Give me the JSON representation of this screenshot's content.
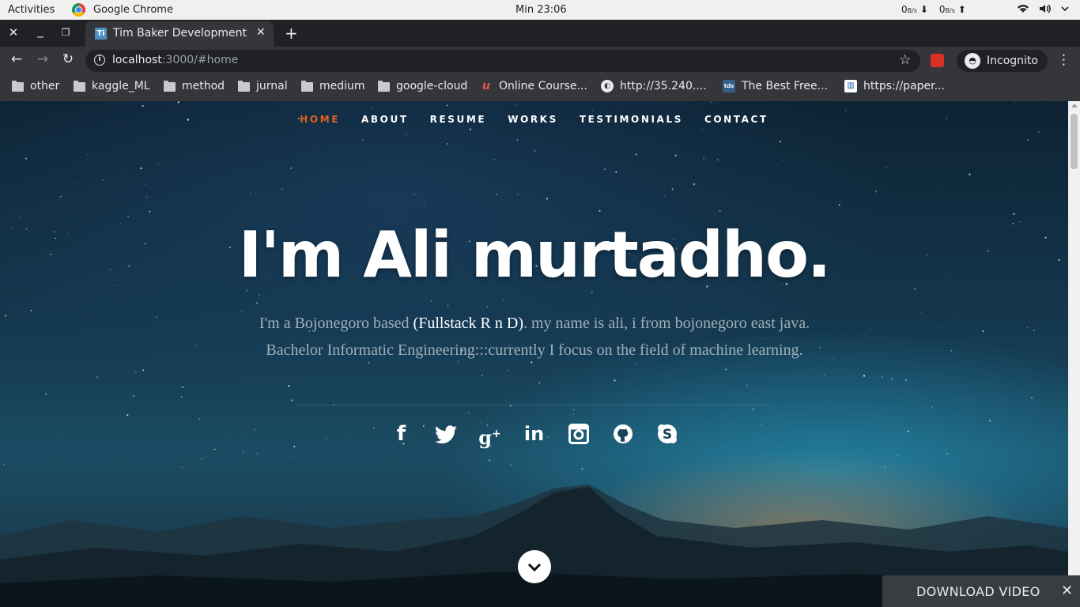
{
  "system_bar": {
    "activities": "Activities",
    "app_name": "Google Chrome",
    "clock": "Min 23:06",
    "down_rate": "0",
    "down_unit": "B/s",
    "up_rate": "0",
    "up_unit": "B/s"
  },
  "tab": {
    "title": "Tim Baker Development",
    "favicon": "Ti"
  },
  "address": {
    "host": "localhost",
    "path": ":3000/#home"
  },
  "profile": {
    "label": "Incognito"
  },
  "bookmarks": [
    {
      "label": "other",
      "icon": "folder-icon"
    },
    {
      "label": "kaggle_ML",
      "icon": "folder-icon"
    },
    {
      "label": "method",
      "icon": "folder-icon"
    },
    {
      "label": "jurnal",
      "icon": "folder-icon"
    },
    {
      "label": "medium",
      "icon": "folder-icon"
    },
    {
      "label": "google-cloud",
      "icon": "folder-icon"
    },
    {
      "label": "Online Course...",
      "icon": "udemy-icon"
    },
    {
      "label": "http://35.240....",
      "icon": "globe-icon"
    },
    {
      "label": "The Best Free...",
      "icon": "tds-icon"
    },
    {
      "label": "https://paper...",
      "icon": "papers-icon"
    }
  ],
  "site": {
    "nav": [
      "HOME",
      "ABOUT",
      "RESUME",
      "WORKS",
      "TESTIMONIALS",
      "CONTACT"
    ],
    "active_nav": "HOME",
    "accent_color": "#e0621d",
    "headline": "I'm Ali murtadho.",
    "desc_before": "I'm a Bojonegoro based ",
    "desc_highlight": "(Fullstack R n D)",
    "desc_after": ". my name is ali, i from bojonegoro east java. Bachelor Informatic Engineering:::currently I focus on the field of machine learning.",
    "social": [
      "facebook-icon",
      "twitter-icon",
      "google-plus-icon",
      "linkedin-icon",
      "instagram-icon",
      "github-icon",
      "skype-icon"
    ]
  },
  "download_bar": {
    "label": "DOWNLOAD VIDEO"
  }
}
